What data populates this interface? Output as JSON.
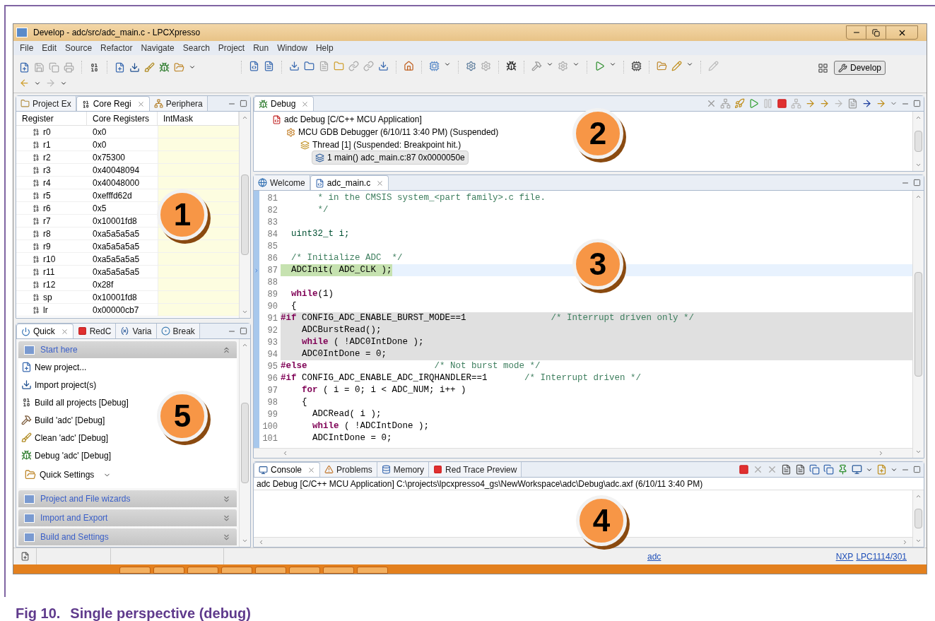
{
  "window": {
    "title": "Develop - adc/src/adc_main.c - LPCXpresso"
  },
  "menu": [
    "File",
    "Edit",
    "Source",
    "Refactor",
    "Navigate",
    "Search",
    "Project",
    "Run",
    "Window",
    "Help"
  ],
  "perspective": {
    "label": "Develop",
    "selected": true
  },
  "registers_panel": {
    "tabs": [
      {
        "label": "Project Ex",
        "kind": "project",
        "selected": false
      },
      {
        "label": "Core Regi",
        "kind": "registers",
        "selected": true
      },
      {
        "label": "Periphera",
        "kind": "peripherals",
        "selected": false
      }
    ],
    "columns": [
      "Register",
      "Core Registers",
      "IntMask"
    ],
    "rows": [
      {
        "name": "r0",
        "value": "0x0"
      },
      {
        "name": "r1",
        "value": "0x0"
      },
      {
        "name": "r2",
        "value": "0x75300"
      },
      {
        "name": "r3",
        "value": "0x40048094"
      },
      {
        "name": "r4",
        "value": "0x40048000"
      },
      {
        "name": "r5",
        "value": "0xefffd62d"
      },
      {
        "name": "r6",
        "value": "0x5"
      },
      {
        "name": "r7",
        "value": "0x10001fd8"
      },
      {
        "name": "r8",
        "value": "0xa5a5a5a5"
      },
      {
        "name": "r9",
        "value": "0xa5a5a5a5"
      },
      {
        "name": "r10",
        "value": "0xa5a5a5a5"
      },
      {
        "name": "r11",
        "value": "0xa5a5a5a5"
      },
      {
        "name": "r12",
        "value": "0x28f"
      },
      {
        "name": "sp",
        "value": "0x10001fd8"
      },
      {
        "name": "lr",
        "value": "0x00000cb7"
      }
    ]
  },
  "quick_panel": {
    "tabs": [
      {
        "label": "Quick",
        "kind": "quick",
        "selected": true
      },
      {
        "label": "RedC",
        "kind": "redc",
        "selected": false
      },
      {
        "label": "Varia",
        "kind": "variables",
        "selected": false
      },
      {
        "label": "Break",
        "kind": "breakpoints",
        "selected": false
      }
    ],
    "sections": [
      {
        "title": "Start here",
        "expanded": true,
        "items": [
          {
            "label": "New project...",
            "kind": "new"
          },
          {
            "label": "Import project(s)",
            "kind": "import"
          },
          {
            "label": "Build all projects [Debug]",
            "kind": "build_all"
          },
          {
            "label": "Build 'adc' [Debug]",
            "kind": "build"
          },
          {
            "label": "Clean 'adc' [Debug]",
            "kind": "clean"
          },
          {
            "label": "Debug 'adc' [Debug]",
            "kind": "debug"
          }
        ],
        "settings": "Quick Settings"
      },
      {
        "title": "Project and File wizards",
        "expanded": false
      },
      {
        "title": "Import and Export",
        "expanded": false
      },
      {
        "title": "Build and Settings",
        "expanded": false
      }
    ]
  },
  "debug_panel": {
    "tabs": [
      {
        "label": "Debug",
        "kind": "debug",
        "selected": true
      }
    ],
    "tree": [
      {
        "label": "adc Debug [C/C++ MCU Application]",
        "kind": "launch",
        "selected": false,
        "children": [
          {
            "label": "MCU GDB Debugger (6/10/11 3:40 PM) (Suspended)",
            "kind": "debugger",
            "selected": false,
            "children": [
              {
                "label": "Thread [1] (Suspended: Breakpoint hit.)",
                "kind": "thread",
                "selected": false,
                "children": [
                  {
                    "label": "1 main() adc_main.c:87 0x0000050e",
                    "kind": "frame",
                    "selected": true
                  }
                ]
              }
            ]
          }
        ]
      }
    ]
  },
  "editor": {
    "tabs": [
      {
        "label": "Welcome",
        "kind": "welcome",
        "selected": false
      },
      {
        "label": "adc_main.c",
        "kind": "cfile",
        "selected": true
      }
    ],
    "lines": [
      {
        "n": "81",
        "current": false,
        "inactive": false,
        "segments": [
          {
            "kind": "comment",
            "text": "       * in the CMSIS system_<part family>.c file."
          }
        ]
      },
      {
        "n": "82",
        "current": false,
        "inactive": false,
        "segments": [
          {
            "kind": "comment",
            "text": "       */"
          }
        ]
      },
      {
        "n": "83",
        "current": false,
        "inactive": false
      },
      {
        "n": "84",
        "current": false,
        "inactive": false,
        "segments": [
          {
            "kind": "type",
            "text": "  uint32_t i;"
          }
        ]
      },
      {
        "n": "85",
        "current": false,
        "inactive": false
      },
      {
        "n": "86",
        "current": false,
        "inactive": false,
        "segments": [
          {
            "kind": "comment",
            "text": "  /* Initialize ADC  */"
          }
        ]
      },
      {
        "n": "87",
        "current": true,
        "inactive": false,
        "segments": [
          {
            "kind": "plain",
            "text": "  ADCInit( ADC_CLK );"
          }
        ]
      },
      {
        "n": "88",
        "current": false,
        "inactive": false
      },
      {
        "n": "89",
        "current": false,
        "inactive": false,
        "segments": [
          {
            "kind": "keyword",
            "text": "  while"
          },
          {
            "kind": "plain",
            "text": "(1)"
          }
        ]
      },
      {
        "n": "90",
        "current": false,
        "inactive": false,
        "segments": [
          {
            "kind": "plain",
            "text": "  {"
          }
        ]
      },
      {
        "n": "91",
        "current": false,
        "inactive": true,
        "segments": [
          {
            "kind": "keyword",
            "text": "#if"
          },
          {
            "kind": "plain",
            "text": " CONFIG_ADC_ENABLE_BURST_MODE==1                "
          },
          {
            "kind": "comment",
            "text": "/* Interrupt driven only */"
          }
        ]
      },
      {
        "n": "92",
        "current": false,
        "inactive": true,
        "segments": [
          {
            "kind": "plain",
            "text": "    ADCBurstRead();"
          }
        ]
      },
      {
        "n": "93",
        "current": false,
        "inactive": true,
        "segments": [
          {
            "kind": "keyword",
            "text": "    while"
          },
          {
            "kind": "plain",
            "text": " ( !ADC0IntDone );"
          }
        ]
      },
      {
        "n": "94",
        "current": false,
        "inactive": true,
        "segments": [
          {
            "kind": "plain",
            "text": "    ADC0IntDone = 0;"
          }
        ]
      },
      {
        "n": "95",
        "current": false,
        "inactive": false,
        "segments": [
          {
            "kind": "keyword",
            "text": "#else"
          },
          {
            "kind": "comment",
            "text": "                        /* Not burst mode */"
          }
        ]
      },
      {
        "n": "96",
        "current": false,
        "inactive": false,
        "segments": [
          {
            "kind": "keyword",
            "text": "#if"
          },
          {
            "kind": "plain",
            "text": " CONFIG_ADC_ENABLE_ADC_IRQHANDLER==1       "
          },
          {
            "kind": "comment",
            "text": "/* Interrupt driven */"
          }
        ]
      },
      {
        "n": "97",
        "current": false,
        "inactive": false,
        "segments": [
          {
            "kind": "keyword",
            "text": "    for"
          },
          {
            "kind": "plain",
            "text": " ( i = 0; i < ADC_NUM; i++ )"
          }
        ]
      },
      {
        "n": "98",
        "current": false,
        "inactive": false,
        "segments": [
          {
            "kind": "plain",
            "text": "    {"
          }
        ]
      },
      {
        "n": "99",
        "current": false,
        "inactive": false,
        "segments": [
          {
            "kind": "plain",
            "text": "      ADCRead( i );"
          }
        ]
      },
      {
        "n": "100",
        "current": false,
        "inactive": false,
        "segments": [
          {
            "kind": "keyword",
            "text": "      while"
          },
          {
            "kind": "plain",
            "text": " ( !ADCIntDone );"
          }
        ]
      },
      {
        "n": "101",
        "current": false,
        "inactive": false,
        "segments": [
          {
            "kind": "plain",
            "text": "      ADCIntDone = 0;"
          }
        ]
      }
    ]
  },
  "console_panel": {
    "tabs": [
      {
        "label": "Console",
        "kind": "console",
        "selected": true
      },
      {
        "label": "Problems",
        "kind": "problems",
        "selected": false
      },
      {
        "label": "Memory",
        "kind": "memory",
        "selected": false
      },
      {
        "label": "Red Trace Preview",
        "kind": "trace",
        "selected": false
      }
    ],
    "header": "adc Debug [C/C++ MCU Application] C:\\projects\\lpcxpresso4_gs\\NewWorkspace\\adc\\Debug\\adc.axf (6/10/11 3:40 PM)"
  },
  "status_bar": {
    "project": "adc",
    "vendor": "NXP",
    "target": "LPC1114/301"
  },
  "callouts": [
    "1",
    "2",
    "3",
    "4",
    "5"
  ],
  "caption": {
    "number": "Fig 10.",
    "text": "Single perspective (debug)"
  }
}
